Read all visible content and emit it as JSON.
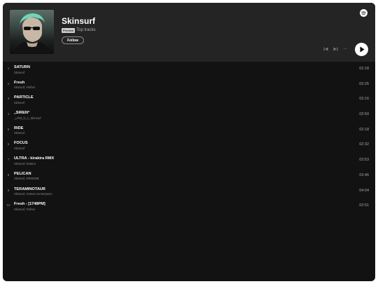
{
  "artist": {
    "name": "Skinsurf",
    "preview_badge": "Preview",
    "subtitle": "Top tracks",
    "follow_label": "Follow",
    "more_label": "···"
  },
  "icons": {
    "logo": "spotify-logo-icon",
    "prev": "skip-previous-icon",
    "next": "skip-next-icon",
    "more": "more-options-icon",
    "play": "play-icon"
  },
  "colors": {
    "panel_bg": "#121212",
    "header_bg": "#242424",
    "text_primary": "#ffffff",
    "text_secondary": "#8a8a8a"
  },
  "tracks": [
    {
      "num": "1",
      "title": "SATURN",
      "artist": "Skinsurf",
      "duration": "02:18"
    },
    {
      "num": "2",
      "title": "Fresh",
      "artist": "Skinsurf, Feliher",
      "duration": "03:25"
    },
    {
      "num": "3",
      "title": "PARTICLE",
      "artist": "Skinsurf",
      "duration": "03:16"
    },
    {
      "num": "4",
      "title": "„SIREN“",
      "artist": "_LPM_O_L_Skinsurf",
      "duration": "03:50"
    },
    {
      "num": "5",
      "title": "RIDE",
      "artist": "Skinsurf",
      "duration": "02:18"
    },
    {
      "num": "6",
      "title": "FOCUS",
      "artist": "Skinsurf",
      "duration": "02:32"
    },
    {
      "num": "7",
      "title": "ULTRA - kirakira RMX",
      "artist": "Skinsurf, kirakira",
      "duration": "03:53"
    },
    {
      "num": "8",
      "title": "PELICAN",
      "artist": "Skinsurf, DRMSDB",
      "duration": "03:46"
    },
    {
      "num": "9",
      "title": "TERAMINOTAUR",
      "artist": "Skinsurf, Human Centerpiece",
      "duration": "04:04"
    },
    {
      "num": "10",
      "title": "Fresh - [1748PM]",
      "artist": "Skinsurf, Feliher",
      "duration": "02:51"
    }
  ]
}
